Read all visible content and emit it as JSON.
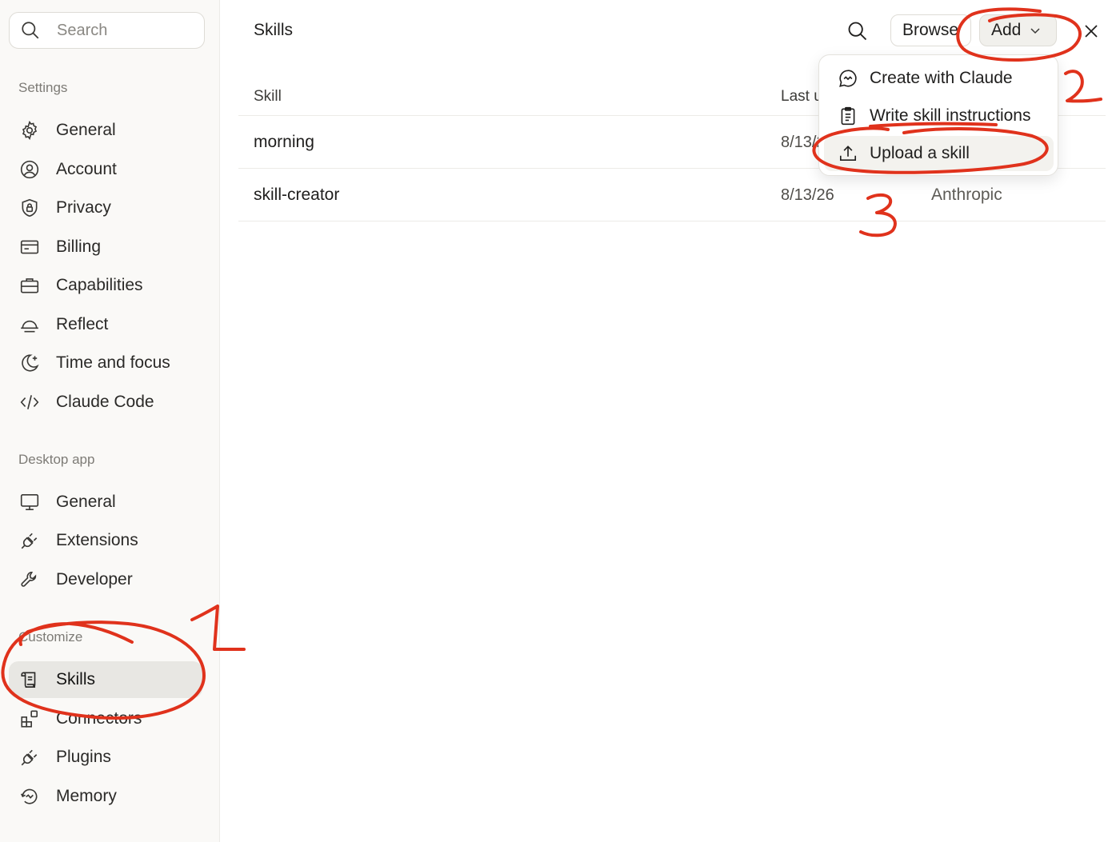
{
  "sidebar": {
    "search": {
      "placeholder": "Search"
    },
    "sections": [
      {
        "label": "Settings"
      },
      {
        "label": "Desktop app"
      },
      {
        "label": "Customize"
      }
    ],
    "settings_items": [
      {
        "label": "General",
        "icon": "gear-icon"
      },
      {
        "label": "Account",
        "icon": "user-circle-icon"
      },
      {
        "label": "Privacy",
        "icon": "shield-lock-icon"
      },
      {
        "label": "Billing",
        "icon": "credit-card-icon"
      },
      {
        "label": "Capabilities",
        "icon": "briefcase-icon"
      },
      {
        "label": "Reflect",
        "icon": "sunrise-icon"
      },
      {
        "label": "Time and focus",
        "icon": "moon-icon"
      },
      {
        "label": "Claude Code",
        "icon": "code-icon"
      }
    ],
    "desktop_items": [
      {
        "label": "General",
        "icon": "monitor-icon"
      },
      {
        "label": "Extensions",
        "icon": "plug-icon"
      },
      {
        "label": "Developer",
        "icon": "wrench-icon"
      }
    ],
    "customize_items": [
      {
        "label": "Skills",
        "icon": "scroll-icon",
        "active": true
      },
      {
        "label": "Connectors",
        "icon": "blocks-icon"
      },
      {
        "label": "Plugins",
        "icon": "plug-icon"
      },
      {
        "label": "Memory",
        "icon": "history-icon"
      }
    ]
  },
  "main": {
    "title": "Skills",
    "browse_label": "Browse",
    "add_label": "Add",
    "table": {
      "headers": [
        "Skill",
        "Last u"
      ],
      "rows": [
        {
          "name": "morning",
          "date": "8/13/2",
          "author": ""
        },
        {
          "name": "skill-creator",
          "date": "8/13/26",
          "author": "Anthropic"
        }
      ]
    },
    "add_menu": [
      {
        "label": "Create with Claude",
        "icon": "chat-bubble-icon"
      },
      {
        "label": "Write skill instructions",
        "icon": "clipboard-icon"
      },
      {
        "label": "Upload a skill",
        "icon": "upload-icon"
      }
    ]
  },
  "annotations": {
    "color": "#e0321c",
    "numbers": [
      "1",
      "2",
      "3"
    ]
  }
}
